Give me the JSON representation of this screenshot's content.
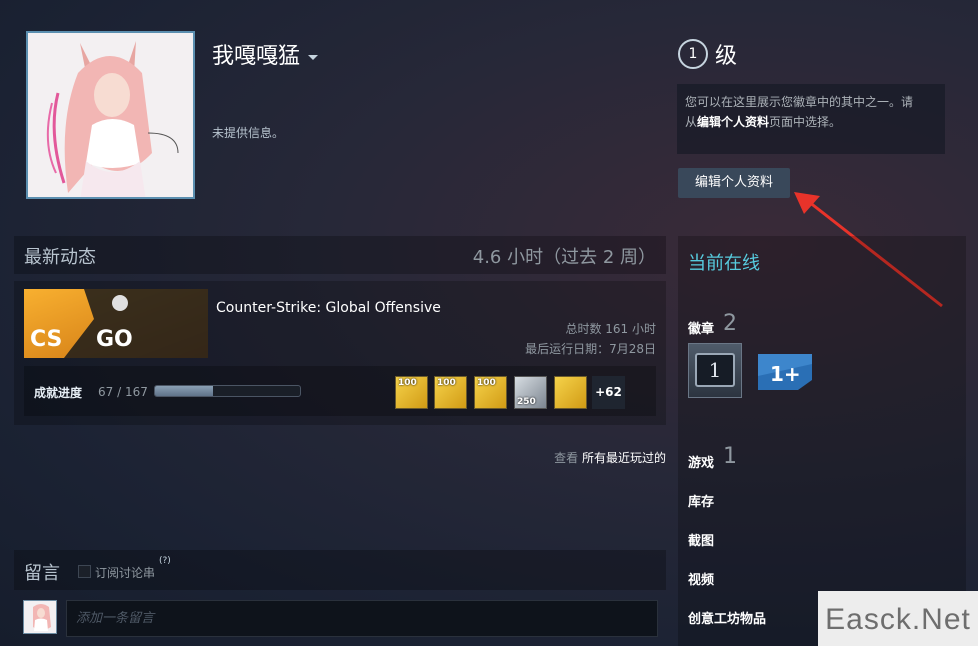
{
  "profile": {
    "username": "我嘎嘎猛",
    "no_info": "未提供信息。"
  },
  "level": {
    "value": "1",
    "label": "级"
  },
  "badge_hint": {
    "line1": "您可以在这里展示您徽章中的其中之一。请",
    "line2_pre": "从",
    "line2_bold": "编辑个人资料",
    "line2_post": "页面中选择。"
  },
  "edit_profile_label": "编辑个人资料",
  "recent": {
    "title": "最新动态",
    "hours": "4.6 小时（过去 2 周）",
    "game": {
      "name": "Counter-Strike: Global Offensive",
      "logo_text_left": "CS",
      "logo_text_right": "GO",
      "total_hours": "总时数 161 小时",
      "last_played": "最后运行日期：7月28日"
    },
    "achievements": {
      "label": "成就进度",
      "count": "67 / 167",
      "progress": 0.4,
      "icons": [
        {
          "name": "100-smg-kills",
          "num": "100"
        },
        {
          "name": "100-ammo-kills",
          "num": "100"
        },
        {
          "name": "100-pistol-kills",
          "num": "100"
        },
        {
          "name": "250-deagle-kills",
          "num": "250"
        },
        {
          "name": "explosion-kills",
          "num": ""
        }
      ],
      "more": "+62"
    },
    "view_all_pre": "查看 ",
    "view_all_link": "所有最近玩过的"
  },
  "comments": {
    "title": "留言",
    "subscribe": "订阅讨论串",
    "help": "(?)",
    "placeholder": "添加一条留言"
  },
  "sidebar": {
    "status": "当前在线",
    "badges_label": "徽章",
    "badges_count": "2",
    "badge1_value": "1",
    "badge2_value": "1+",
    "games_label": "游戏",
    "games_count": "1",
    "inventory": "库存",
    "screenshots": "截图",
    "videos": "视频",
    "workshop": "创意工坊物品"
  },
  "watermark": "Easck.Net",
  "colors": {
    "status": "#57cbde",
    "arrow": "#e8332a",
    "badge_blue": "#2a6fb5"
  }
}
